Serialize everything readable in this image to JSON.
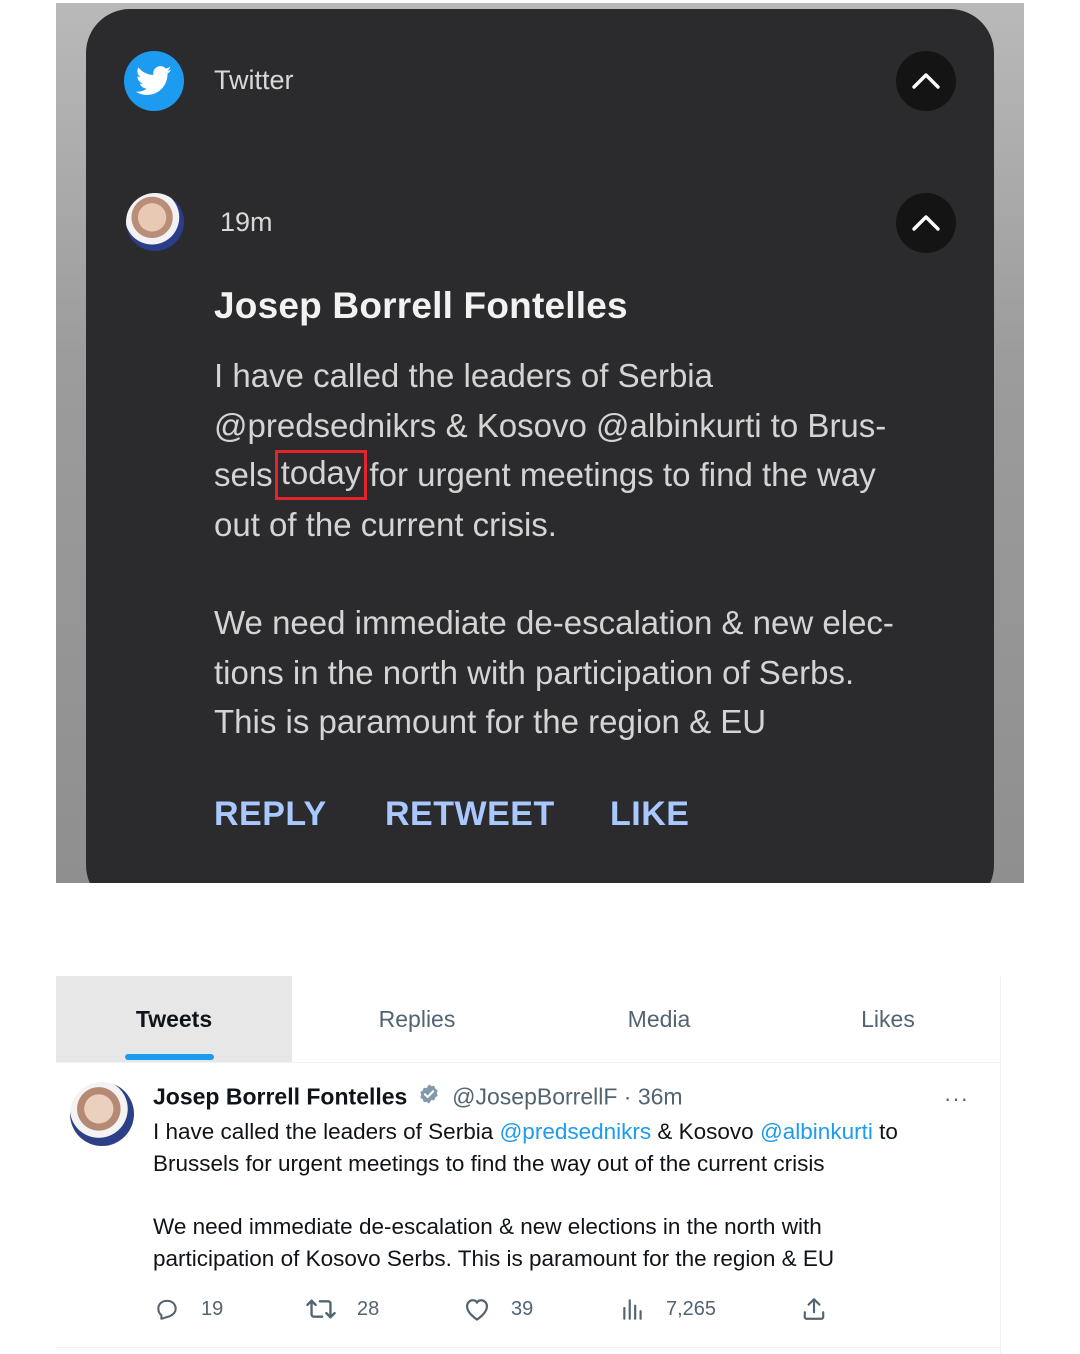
{
  "notification": {
    "app_name": "Twitter",
    "time": "19m",
    "author": "Josep Borrell Fontelles",
    "body_lines_p1": [
      "I have called the leaders of Serbia",
      "@predsednikrs & Kosovo @albinkurti to Brus-"
    ],
    "line3_before": "sels",
    "line3_highlight": "today",
    "line3_after": "for urgent meetings to find the way",
    "line4": "out of the current crisis.",
    "body_lines_p2": [
      "We need immediate de-escalation & new elec-",
      "tions in the north with participation of Serbs.",
      "This is paramount for the region & EU"
    ],
    "actions": {
      "reply": "REPLY",
      "retweet": "RETWEET",
      "like": "LIKE"
    },
    "highlight_color": "#e3262d"
  },
  "profile": {
    "tabs": [
      {
        "label": "Tweets",
        "selected": true
      },
      {
        "label": "Replies",
        "selected": false
      },
      {
        "label": "Media",
        "selected": false
      },
      {
        "label": "Likes",
        "selected": false
      }
    ],
    "tweet": {
      "name": "Josep Borrell Fontelles",
      "handle": "@JosepBorrellF",
      "separator": "·",
      "time": "36m",
      "more": "···",
      "line1_pre": "I have called the leaders of Serbia ",
      "line1_mention1": "@predsednikrs",
      "line1_mid": " & Kosovo ",
      "line1_mention2": "@albinkurti",
      "line1_post": " to",
      "line2": "Brussels for urgent meetings to find the way out of the current crisis",
      "line3": "We need immediate de-escalation & new elections in the north with",
      "line4": "participation of Kosovo Serbs. This is paramount for the region & EU",
      "replies": "19",
      "retweets": "28",
      "likes": "39",
      "views": "7,265"
    },
    "accent_color": "#1d9bf0"
  }
}
